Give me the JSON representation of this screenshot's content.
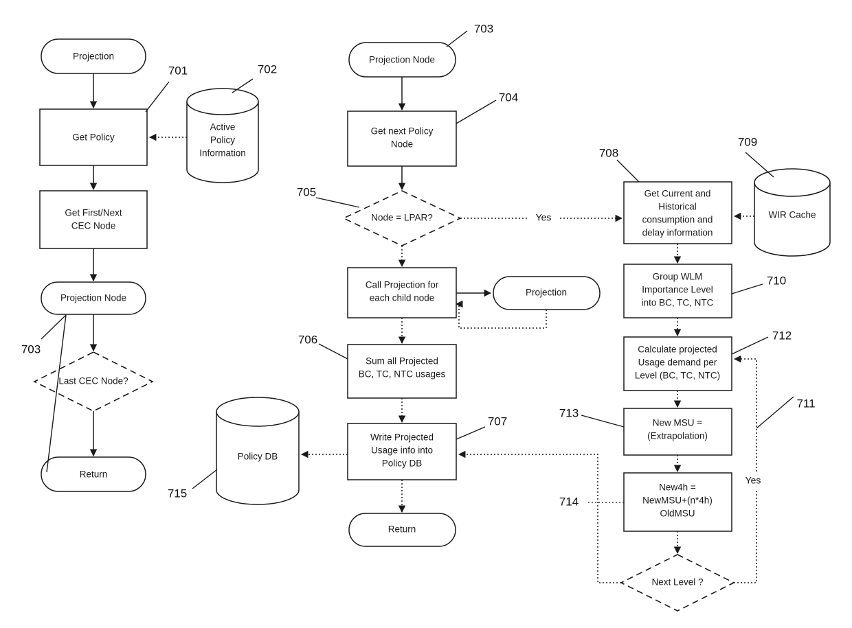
{
  "diagram": {
    "title": "Projection flowchart",
    "colors": {
      "stroke": "#1a1a1a",
      "fill": "#ffffff",
      "background": "#ffffff"
    },
    "nodes": {
      "projection_start": "Projection",
      "get_policy": "Get Policy",
      "get_first_next_cec_node": "Get First/Next\nCEC Node",
      "get_first_next_cec_node_l1": "Get First/Next",
      "get_first_next_cec_node_l2": "CEC Node",
      "projection_node_left": "Projection Node",
      "last_cec_node": "Last CEC Node?",
      "return_left": "Return",
      "active_policy_information_l1": "Active",
      "active_policy_information_l2": "Policy",
      "active_policy_information_l3": "Information",
      "projection_node_mid": "Projection Node",
      "get_next_policy_node_l1": "Get next Policy",
      "get_next_policy_node_l2": "Node",
      "node_eq_lpar": "Node = LPAR?",
      "call_projection_l1": "Call Projection for",
      "call_projection_l2": "each child node",
      "projection_sub": "Projection",
      "sum_all_projected_l1": "Sum all Projected",
      "sum_all_projected_l2": "BC, TC, NTC usages",
      "write_projected_l1": "Write Projected",
      "write_projected_l2": "Usage info into",
      "write_projected_l3": "Policy DB",
      "return_mid": "Return",
      "policy_db": "Policy DB",
      "get_current_historical_l1": "Get Current and",
      "get_current_historical_l2": "Historical",
      "get_current_historical_l3": "consumption and",
      "get_current_historical_l4": "delay information",
      "wir_cache": "WIR Cache",
      "group_wlm_l1": "Group WLM",
      "group_wlm_l2": "Importance Level",
      "group_wlm_l3": "into BC, TC, NTC",
      "calculate_projected_l1": "Calculate projected",
      "calculate_projected_l2": "Usage demand per",
      "calculate_projected_l3": "Level (BC, TC, NTC)",
      "new_msu_l1": "New MSU =",
      "new_msu_l2": "(Extrapolation)",
      "new4h_l1": "New4h =",
      "new4h_l2": "NewMSU+(n*4h)",
      "new4h_l3": "OldMSU",
      "next_level": "Next Level ?"
    },
    "edge_labels": {
      "lpar_yes": "Yes",
      "next_level_yes": "Yes"
    },
    "reference_numerals": {
      "r701": "701",
      "r702": "702",
      "r703_left": "703",
      "r703_mid": "703",
      "r704": "704",
      "r705": "705",
      "r706": "706",
      "r707": "707",
      "r708": "708",
      "r709": "709",
      "r710": "710",
      "r711": "711",
      "r712": "712",
      "r713": "713",
      "r714": "714",
      "r715": "715"
    }
  }
}
